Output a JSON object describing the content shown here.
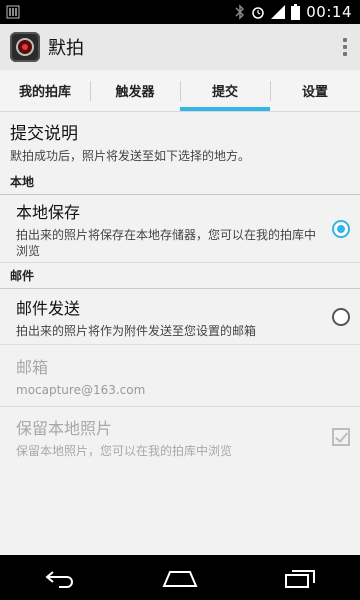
{
  "status_bar": {
    "time": "00:14",
    "icons": [
      "notification-icon",
      "bluetooth-icon",
      "alarm-icon",
      "signal-icon",
      "battery-icon"
    ]
  },
  "action_bar": {
    "title": "默拍",
    "icon": "camera-app-icon",
    "overflow_icon": "overflow-menu-icon"
  },
  "tabs": [
    {
      "label": "我的拍库",
      "active": false
    },
    {
      "label": "触发器",
      "active": false
    },
    {
      "label": "提交",
      "active": true
    },
    {
      "label": "设置",
      "active": false
    }
  ],
  "content": {
    "intro": {
      "title": "提交说明",
      "summary": "默拍成功后，照片将发送至如下选择的地方。"
    },
    "local_category": "本地",
    "local_save": {
      "title": "本地保存",
      "summary": "拍出来的照片将保存在本地存储器，您可以在我的拍库中浏览",
      "checked": true
    },
    "mail_category": "邮件",
    "mail_send": {
      "title": "邮件发送",
      "summary": "拍出来的照片将作为附件发送至您设置的邮箱",
      "checked": false
    },
    "mailbox": {
      "title": "邮箱",
      "value": "mocapture@163.com"
    },
    "keep_local": {
      "title": "保留本地照片",
      "summary": "保留本地照片，您可以在我的拍库中浏览",
      "checked": true
    }
  },
  "nav_bar": {
    "icons": [
      "back-icon",
      "home-icon",
      "recents-icon"
    ]
  },
  "colors": {
    "accent": "#33b5e5",
    "status_bar": "#000000",
    "action_bar": "#e8e8e8"
  }
}
